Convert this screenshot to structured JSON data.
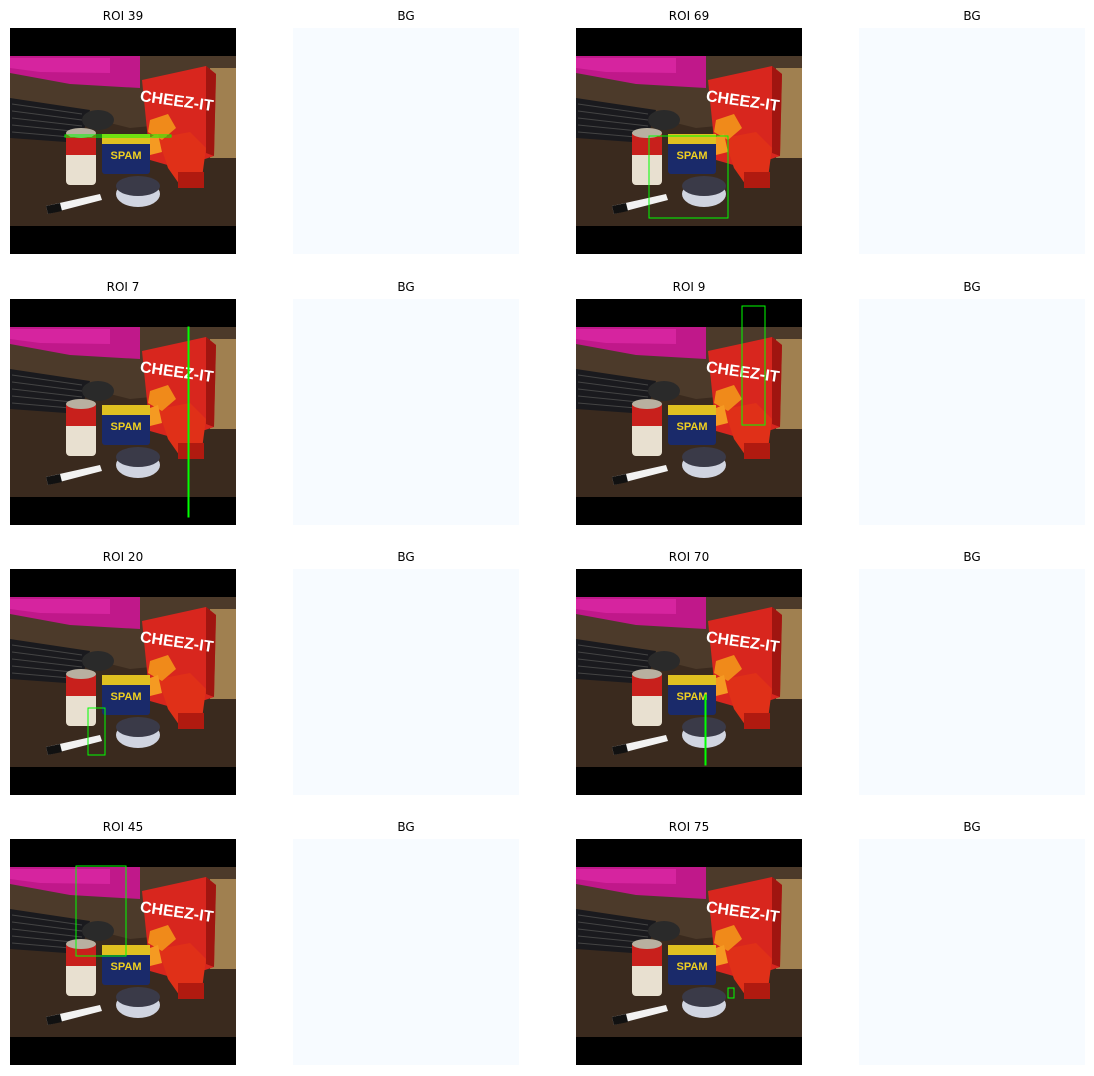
{
  "colors": {
    "background_panel": "#f7fbff",
    "box_outline": "#00ff00",
    "letterbox": "#000000"
  },
  "panels": [
    {
      "kind": "roi",
      "title": "ROI 39"
    },
    {
      "kind": "bg",
      "title": "BG"
    },
    {
      "kind": "roi",
      "title": "ROI 69"
    },
    {
      "kind": "bg",
      "title": "BG"
    },
    {
      "kind": "roi",
      "title": "ROI 7"
    },
    {
      "kind": "bg",
      "title": "BG"
    },
    {
      "kind": "roi",
      "title": "ROI 9"
    },
    {
      "kind": "bg",
      "title": "BG"
    },
    {
      "kind": "roi",
      "title": "ROI 20"
    },
    {
      "kind": "bg",
      "title": "BG"
    },
    {
      "kind": "roi",
      "title": "ROI 70"
    },
    {
      "kind": "bg",
      "title": "BG"
    },
    {
      "kind": "roi",
      "title": "ROI 45"
    },
    {
      "kind": "bg",
      "title": "BG"
    },
    {
      "kind": "roi",
      "title": "ROI 75"
    },
    {
      "kind": "bg",
      "title": "BG"
    }
  ],
  "scene_labels": {
    "box_brand": "CHEEZ-IT",
    "tin_brand": "SPAM"
  }
}
